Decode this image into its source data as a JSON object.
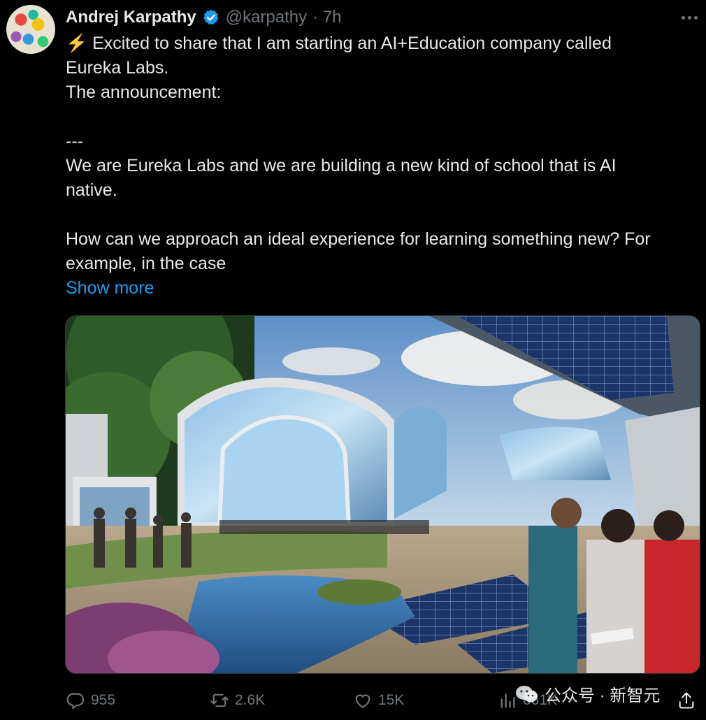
{
  "author": {
    "name": "Andrej Karpathy",
    "handle": "@karpathy",
    "time": "· 7h"
  },
  "tweet": {
    "text": "⚡ Excited to share that I am starting an AI+Education company called\nEureka Labs.\nThe announcement:\n\n---\nWe are Eureka Labs and we are building a new kind of school that is AI\nnative.\n\nHow can we approach an ideal experience for learning something new? For\nexample, in the case",
    "show_more": "Show more"
  },
  "actions": {
    "replies": "955",
    "reposts": "2.6K",
    "likes": "15K",
    "views": "661K"
  },
  "watermark": {
    "text": "公众号 · 新智元"
  },
  "colors": {
    "background": "#000000",
    "text": "#e7e9ea",
    "secondary": "#71767b",
    "link": "#1d9bf0",
    "verified": "#1d9bf0"
  },
  "icons": [
    "verified-badge-icon",
    "more-icon",
    "reply-icon",
    "repost-icon",
    "like-icon",
    "views-icon",
    "share-icon",
    "wechat-icon"
  ]
}
